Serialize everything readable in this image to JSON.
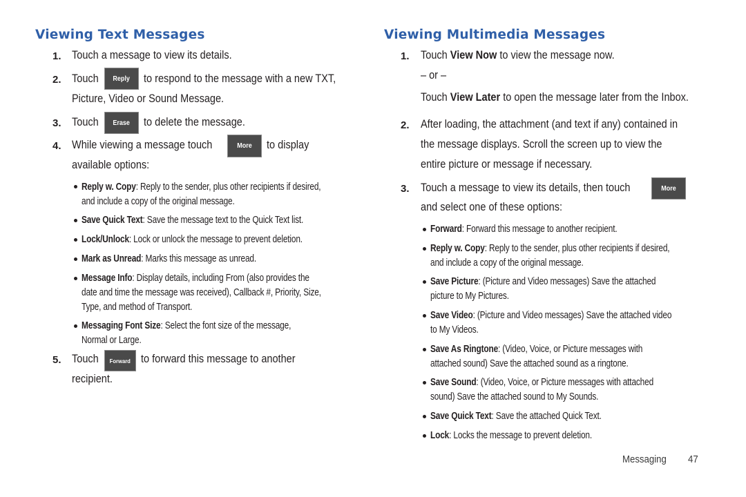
{
  "left": {
    "title": "Viewing Text Messages",
    "steps": [
      {
        "num": "1.",
        "lines": [
          "Touch a message to view its details."
        ]
      },
      {
        "num": "2.",
        "pre": "Touch",
        "button": "Reply",
        "post": "to respond to the message with a new TXT,",
        "lines": [
          "Picture, Video or Sound Message."
        ]
      },
      {
        "num": "3.",
        "pre": "Touch",
        "button": "Erase",
        "post": "to delete the message."
      },
      {
        "num": "4.",
        "pre": "While viewing a message touch",
        "button": "More",
        "post": "to display",
        "lines": [
          "available options:"
        ]
      },
      {
        "num": "5.",
        "pre": "Touch",
        "button": "Forward",
        "post": "to forward this message to another",
        "lines": [
          "recipient."
        ]
      }
    ],
    "options": [
      {
        "term": "Reply w. Copy",
        "lines": [
          ": Reply to the sender, plus other recipients if desired,",
          "and include a copy of the original message."
        ]
      },
      {
        "term": "Save Quick Text",
        "lines": [
          ": Save the message text to the Quick Text list."
        ]
      },
      {
        "term": "Lock/Unlock",
        "lines": [
          ": Lock or unlock the message to prevent deletion."
        ]
      },
      {
        "term": "Mark as Unread",
        "lines": [
          ": Marks this message as unread."
        ]
      },
      {
        "term": "Message Info",
        "lines": [
          ": Display details, including From (also provides the",
          "date and time the message was received), Callback #, Priority, Size,",
          "Type, and method of Transport."
        ]
      },
      {
        "term": "Messaging Font Size",
        "lines": [
          ": Select the font size of the message,",
          "Normal or Large."
        ]
      }
    ]
  },
  "right": {
    "title": "Viewing Multimedia Messages",
    "steps": [
      {
        "num": "1.",
        "pre": "Touch ",
        "bold": "View Now",
        "post": " to view the message now.",
        "or": "– or –",
        "alt_pre": "Touch ",
        "alt_bold": "View Later",
        "alt_post": " to open the message later from the Inbox."
      },
      {
        "num": "2.",
        "lines": [
          "After loading, the attachment (and text if any) contained in",
          "the message displays. Scroll the screen up to view the",
          "entire picture or message if necessary."
        ]
      },
      {
        "num": "3.",
        "pre": "Touch a message to view its details, then touch",
        "button": "More",
        "lines": [
          "and select one of these options:"
        ]
      }
    ],
    "options": [
      {
        "term": "Forward",
        "lines": [
          ": Forward this message to another recipient."
        ]
      },
      {
        "term": "Reply w. Copy",
        "lines": [
          ": Reply to the sender, plus other recipients if desired,",
          "and include a copy of the original message."
        ]
      },
      {
        "term": "Save Picture",
        "lines": [
          ": (Picture and Video messages) Save the attached",
          "picture to My Pictures."
        ]
      },
      {
        "term": "Save Video",
        "lines": [
          ": (Picture and Video messages) Save the attached video",
          "to My Videos."
        ]
      },
      {
        "term": "Save As Ringtone",
        "lines": [
          ": (Video, Voice, or Picture messages with",
          "attached sound) Save the attached sound as a ringtone."
        ]
      },
      {
        "term": "Save Sound",
        "lines": [
          ": (Video, Voice, or Picture messages with attached",
          "sound) Save the attached sound to My Sounds."
        ]
      },
      {
        "term": "Save Quick Text",
        "lines": [
          ": Save the attached Quick Text."
        ]
      },
      {
        "term": "Lock",
        "lines": [
          ": Locks the message to prevent deletion."
        ]
      }
    ]
  },
  "footer": {
    "section": "Messaging",
    "page_number": "47"
  },
  "colors": {
    "heading": "#2f5fa8",
    "button_bg": "#4a4a4a",
    "text": "#231f20"
  }
}
